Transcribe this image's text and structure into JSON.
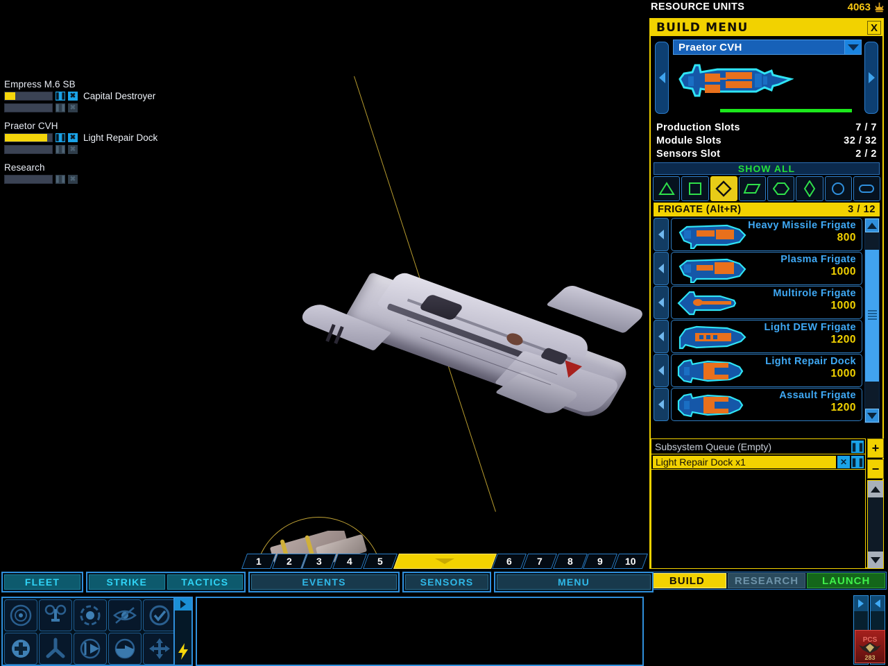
{
  "resource": {
    "label": "RESOURCE UNITS",
    "value": "4063",
    "icon": "resource-crystal-icon"
  },
  "build_status": {
    "groups": [
      {
        "title": "Empress M.6 SB",
        "rows": [
          {
            "progress": 22,
            "item": "Capital Destroyer",
            "active": true
          },
          {
            "progress": 0,
            "item": "",
            "active": false
          }
        ]
      },
      {
        "title": "Praetor CVH",
        "rows": [
          {
            "progress": 90,
            "item": "Light Repair Dock",
            "active": true
          },
          {
            "progress": 0,
            "item": "",
            "active": false
          }
        ]
      },
      {
        "title": "Research",
        "rows": [
          {
            "progress": 0,
            "item": "",
            "active": false
          }
        ]
      }
    ],
    "pause_glyph": "❚❚",
    "cancel_glyph": "✖"
  },
  "build_menu": {
    "title": "BUILD MENU",
    "close_label": "X",
    "selected_ship": "Praetor CVH",
    "prev_label": "◀",
    "next_label": "▶",
    "dropdown_label": "▼",
    "stats": [
      {
        "name": "Production Slots",
        "value": "7 / 7"
      },
      {
        "name": "Module Slots",
        "value": "32 / 32"
      },
      {
        "name": "Sensors Slot",
        "value": "2 / 2"
      }
    ],
    "show_all_label": "SHOW ALL",
    "class_filters": [
      {
        "name": "class-filter-fighter",
        "shape": "triangle",
        "active": false
      },
      {
        "name": "class-filter-corvette",
        "shape": "square",
        "active": false
      },
      {
        "name": "class-filter-frigate",
        "shape": "diamond",
        "active": true
      },
      {
        "name": "class-filter-cruiser",
        "shape": "parallelogram",
        "active": false
      },
      {
        "name": "class-filter-capital",
        "shape": "hexagon",
        "active": false
      },
      {
        "name": "class-filter-dreadnought",
        "shape": "tall-diamond",
        "active": false
      },
      {
        "name": "class-filter-station",
        "shape": "circle",
        "active": false
      },
      {
        "name": "class-filter-module",
        "shape": "rounded-rect",
        "active": false
      }
    ],
    "section": {
      "label": "FRIGATE (Alt+R)",
      "count": "3 / 12"
    },
    "items": [
      {
        "name": "Heavy Missile Frigate",
        "cost": "800"
      },
      {
        "name": "Plasma Frigate",
        "cost": "1000"
      },
      {
        "name": "Multirole Frigate",
        "cost": "1000"
      },
      {
        "name": "Light DEW Frigate",
        "cost": "1200"
      },
      {
        "name": "Light Repair Dock",
        "cost": "1000"
      },
      {
        "name": "Assault Frigate",
        "cost": "1200"
      }
    ]
  },
  "queue": {
    "header_label": "Subsystem Queue (Empty)",
    "header_pause": "❚❚",
    "items": [
      {
        "label": "Light Repair Dock x1",
        "cancel": "✕",
        "pause": "❚❚"
      }
    ],
    "add_label": "+",
    "remove_label": "−",
    "scroll_up": "▲",
    "scroll_down": "▼"
  },
  "mode_buttons": [
    {
      "label": "BUILD",
      "state": "active"
    },
    {
      "label": "RESEARCH",
      "state": "inactive"
    },
    {
      "label": "LAUNCH",
      "state": "enabled"
    }
  ],
  "bottom_bar": {
    "tabs": [
      "1",
      "2",
      "3",
      "4",
      "5",
      "",
      "6",
      "7",
      "8",
      "9",
      "10"
    ],
    "active_tab_index": 5,
    "groups": [
      {
        "buttons": [
          {
            "label": "FLEET",
            "style": "bright"
          }
        ]
      },
      {
        "buttons": [
          {
            "label": "STRIKE",
            "style": "bright"
          },
          {
            "label": "TACTICS",
            "style": "bright"
          }
        ]
      },
      {
        "buttons": [
          {
            "label": "EVENTS",
            "style": "dim"
          }
        ]
      },
      {
        "buttons": [
          {
            "label": "SENSORS",
            "style": "dim"
          }
        ]
      },
      {
        "buttons": [
          {
            "label": "MENU",
            "style": "dim"
          }
        ]
      }
    ],
    "commands_row1": [
      "scan-target-icon",
      "formation-icon",
      "move-to-icon",
      "cloak-icon",
      "confirm-icon"
    ],
    "commands_row2": [
      "repair-icon",
      "dock-icon",
      "attack-arc-icon",
      "patrol-arc-icon",
      "move-free-icon"
    ],
    "flash_icon": "lightning-icon",
    "expand_icon": "expand-arrow-icon",
    "scroll_right": "▶",
    "scroll_left": "◀",
    "emblem_label": "PCS"
  }
}
